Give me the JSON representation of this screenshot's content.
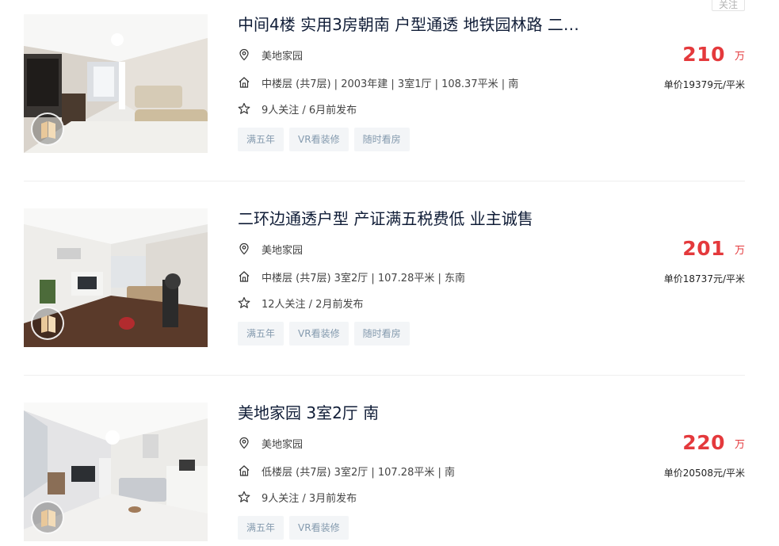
{
  "follow_button": {
    "label": "关注"
  },
  "icons": {
    "position": "location-pin-icon",
    "house": "house-icon",
    "follow": "star-icon",
    "vr": "vr-badge-icon"
  },
  "colors": {
    "price": "#e4393c",
    "title": "#101d37",
    "tag_text": "#849aae",
    "tag_bg": "#f3f5f7"
  },
  "listings": [
    {
      "title": "中间4楼 实用3房朝南 户型通透 地铁园林路 二…",
      "community": "美地家园",
      "house_info": "中楼层 (共7层) | 2003年建 | 3室1厅 | 108.37平米 | 南",
      "follow_info": "9人关注 / 6月前发布",
      "tags": [
        "满五年",
        "VR看装修",
        "随时看房"
      ],
      "total_price": "210",
      "total_unit": "万",
      "unit_price": "单价19379元/平米"
    },
    {
      "title": "二环边通透户型 产证满五税费低 业主诚售",
      "community": "美地家园",
      "house_info": "中楼层 (共7层) 3室2厅 | 107.28平米 | 东南",
      "follow_info": "12人关注 / 2月前发布",
      "tags": [
        "满五年",
        "VR看装修",
        "随时看房"
      ],
      "total_price": "201",
      "total_unit": "万",
      "unit_price": "单价18737元/平米"
    },
    {
      "title": "美地家园 3室2厅 南",
      "community": "美地家园",
      "house_info": "低楼层 (共7层) 3室2厅 | 107.28平米 | 南",
      "follow_info": "9人关注 / 3月前发布",
      "tags": [
        "满五年",
        "VR看装修"
      ],
      "total_price": "220",
      "total_unit": "万",
      "unit_price": "单价20508元/平米"
    }
  ]
}
